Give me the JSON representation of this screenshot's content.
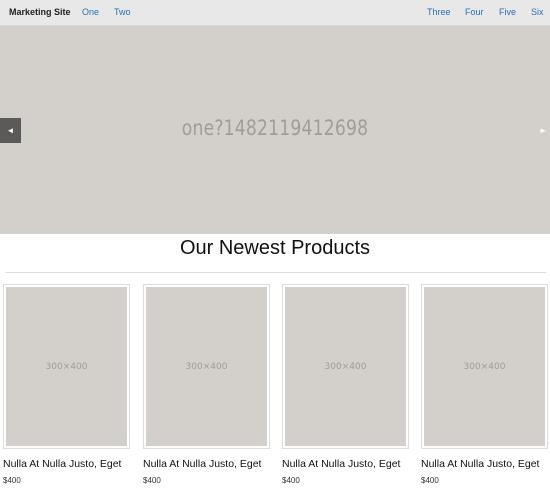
{
  "header": {
    "brand": "Marketing Site",
    "nav_left": [
      "One",
      "Two"
    ],
    "nav_right": [
      "Three",
      "Four",
      "Five",
      "Six"
    ]
  },
  "hero": {
    "slide_text": "one?1482119412698",
    "prev_icon": "◄",
    "next_icon": "►"
  },
  "products_section": {
    "title": "Our Newest Products",
    "items": [
      {
        "image_text": "300×400",
        "title": "Nulla At Nulla Justo, Eget",
        "price": "$400"
      },
      {
        "image_text": "300×400",
        "title": "Nulla At Nulla Justo, Eget",
        "price": "$400"
      },
      {
        "image_text": "300×400",
        "title": "Nulla At Nulla Justo, Eget",
        "price": "$400"
      },
      {
        "image_text": "300×400",
        "title": "Nulla At Nulla Justo, Eget",
        "price": "$400"
      }
    ]
  },
  "colors": {
    "topbar_bg": "#e8e8e8",
    "link": "#2a6fb3",
    "placeholder_bg": "#d3cfca",
    "placeholder_text": "#a09c97"
  }
}
